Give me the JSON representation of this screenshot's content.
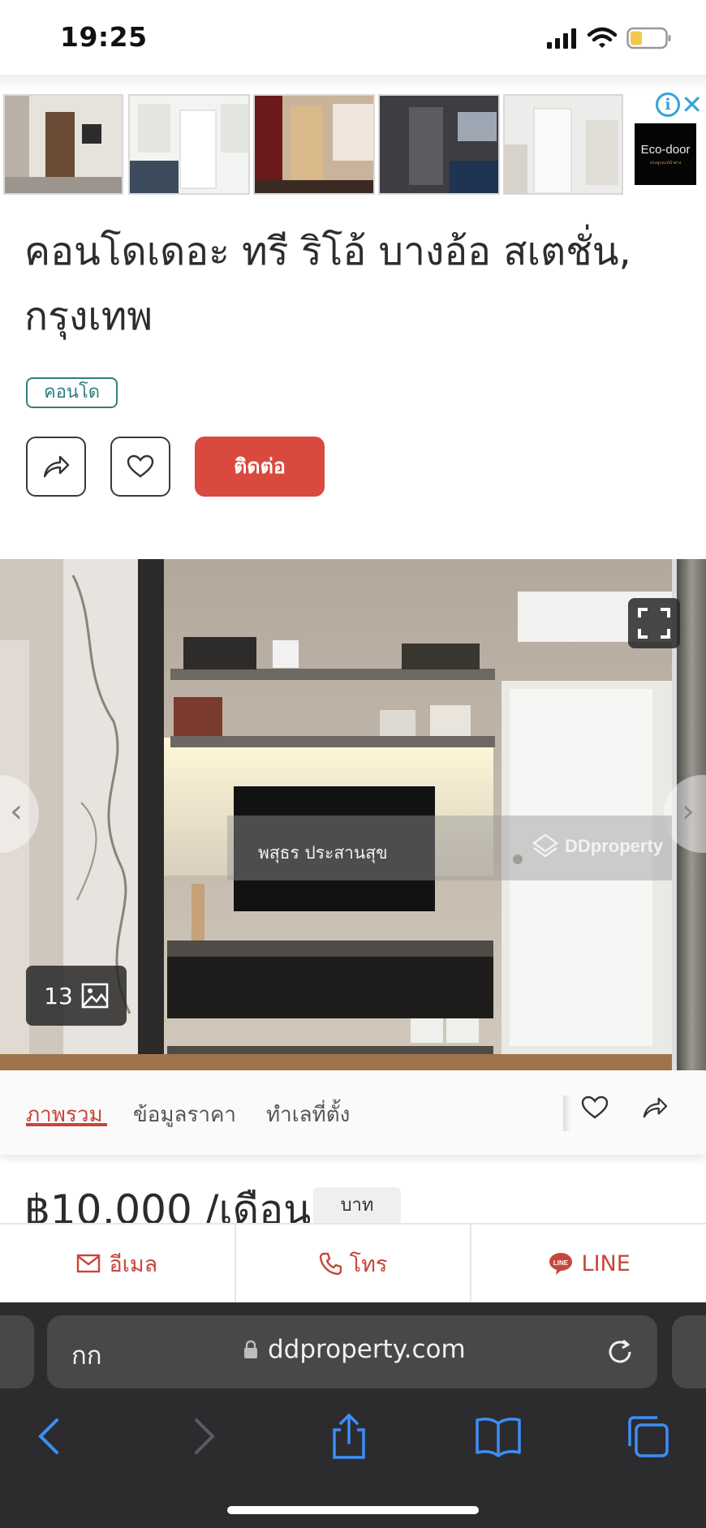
{
  "status_bar": {
    "time": "19:25",
    "icons": [
      "signal-icon",
      "wifi-icon",
      "battery-icon"
    ]
  },
  "ad": {
    "brand": "Eco-door",
    "icons": [
      "ad-info-icon",
      "ad-close-icon"
    ]
  },
  "listing": {
    "title": "คอนโดเดอะ ทรี ริโอ้ บางอ้อ สเตชั่น, กรุงเทพ",
    "tag": "คอนโด",
    "contact_label": "ติดต่อ"
  },
  "gallery": {
    "photo_count": "13",
    "watermark_name": "พสุธร ประสานสุข",
    "watermark_brand": "DDproperty"
  },
  "tabs": [
    {
      "label": "ภาพรวม",
      "active": true
    },
    {
      "label": "ข้อมูลราคา",
      "active": false
    },
    {
      "label": "ทำเลที่ตั้ง",
      "active": false
    }
  ],
  "price": {
    "text": "฿10,000 /เดือน",
    "currency_chip": "บาท"
  },
  "contact_bar": {
    "email": "อีเมล",
    "call": "โทร",
    "line": "LINE"
  },
  "browser": {
    "text_size": "กก",
    "url": "ddproperty.com"
  },
  "colors": {
    "accent": "#d9493e",
    "tag": "#2f7f80",
    "safari_bg": "#2c2c2e",
    "link_blue": "#3d8ef7"
  }
}
